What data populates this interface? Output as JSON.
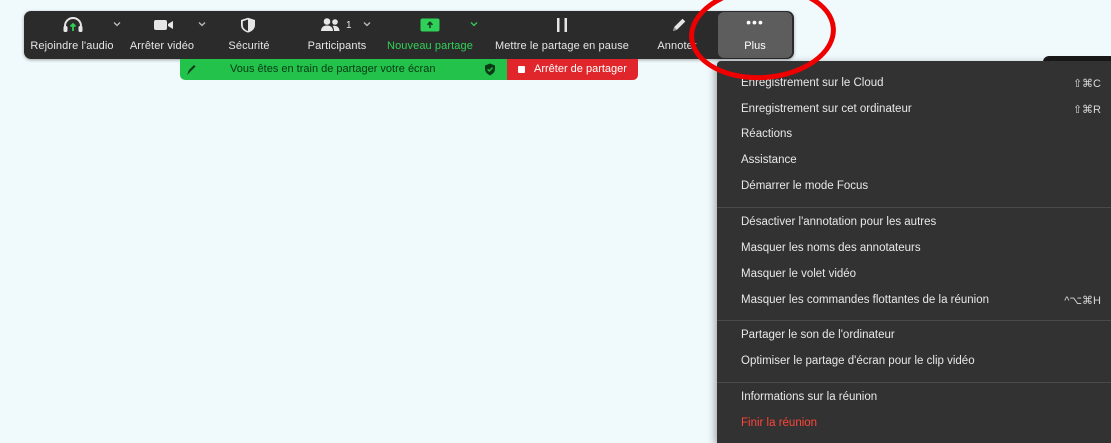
{
  "toolbar": {
    "audio": {
      "label": "Rejoindre l'audio",
      "icon": "headphones-icon"
    },
    "video": {
      "label": "Arrêter vidéo",
      "icon": "video-camera-icon"
    },
    "security": {
      "label": "Sécurité",
      "icon": "shield-icon"
    },
    "participants": {
      "label": "Participants",
      "count": "1",
      "icon": "participants-icon"
    },
    "new_share": {
      "label": "Nouveau partage",
      "icon": "share-screen-icon"
    },
    "pause_share": {
      "label": "Mettre le partage en pause",
      "icon": "pause-icon"
    },
    "annotate": {
      "label": "Annoter",
      "icon": "pencil-icon"
    },
    "more": {
      "label": "Plus",
      "icon": "more-dots-icon"
    }
  },
  "banner": {
    "message": "Vous êtes en train de partager votre écran",
    "stop_label": "Arrêter de partager"
  },
  "menu": {
    "items": [
      {
        "label": "Enregistrement sur le Cloud",
        "shortcut": "⇧⌘C"
      },
      {
        "label": "Enregistrement sur cet ordinateur",
        "shortcut": "⇧⌘R"
      },
      {
        "label": "Réactions",
        "shortcut": ""
      },
      {
        "label": "Assistance",
        "shortcut": ""
      },
      {
        "label": "Démarrer le mode Focus",
        "shortcut": ""
      },
      {
        "label": "Désactiver l'annotation pour les autres",
        "shortcut": ""
      },
      {
        "label": "Masquer les noms des annotateurs",
        "shortcut": ""
      },
      {
        "label": "Masquer le volet vidéo",
        "shortcut": ""
      },
      {
        "label": "Masquer les commandes flottantes de la réunion",
        "shortcut": "^⌥⌘H"
      },
      {
        "label": "Partager le son de l'ordinateur",
        "shortcut": ""
      },
      {
        "label": "Optimiser le partage d'écran pour le clip vidéo",
        "shortcut": ""
      },
      {
        "label": "Informations sur la réunion",
        "shortcut": ""
      },
      {
        "label": "Finir la réunion",
        "shortcut": ""
      }
    ]
  },
  "colors": {
    "toolbar_bg": "#2b2b2b",
    "accent_green": "#30d158",
    "banner_green": "#23c24a",
    "banner_red": "#e0262b",
    "menu_bg": "#323232",
    "danger_text": "#ff453a",
    "annotation_circle": "#ee0000"
  }
}
